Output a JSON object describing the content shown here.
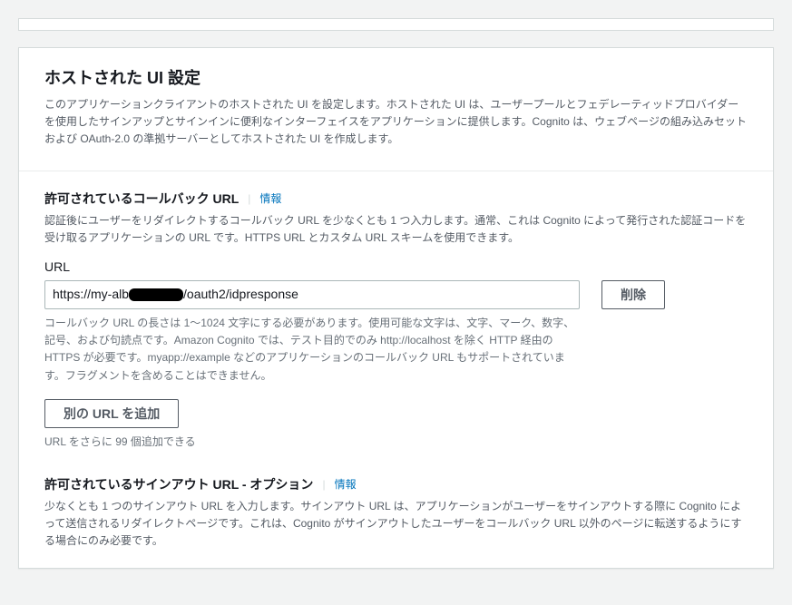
{
  "hostedUi": {
    "title": "ホストされた UI 設定",
    "description": "このアプリケーションクライアントのホストされた UI を設定します。ホストされた UI は、ユーザープールとフェデレーティッドプロバイダーを使用したサインアップとサインインに便利なインターフェイスをアプリケーションに提供します。Cognito は、ウェブページの組み込みセットおよび OAuth-2.0 の準拠サーバーとしてホストされた UI を作成します。"
  },
  "callback": {
    "title": "許可されているコールバック URL",
    "info": "情報",
    "description": "認証後にユーザーをリダイレクトするコールバック URL を少なくとも 1 つ入力します。通常、これは Cognito によって発行された認証コードを受け取るアプリケーションの URL です。HTTPS URL とカスタム URL スキームを使用できます。",
    "label": "URL",
    "value_prefix": "https://my-alb",
    "value_suffix": "/oauth2/idpresponse",
    "deleteLabel": "削除",
    "help": "コールバック URL の長さは 1〜1024 文字にする必要があります。使用可能な文字は、文字、マーク、数字、記号、および句読点です。Amazon Cognito では、テスト目的でのみ http://localhost を除く HTTP 経由の HTTPS が必要です。myapp://example などのアプリケーションのコールバック URL もサポートされています。フラグメントを含めることはできません。",
    "addLabel": "別の URL を追加",
    "remaining": "URL をさらに 99 個追加できる"
  },
  "signout": {
    "title": "許可されているサインアウト URL - オプション",
    "info": "情報",
    "description": "少なくとも 1 つのサインアウト URL を入力します。サインアウト URL は、アプリケーションがユーザーをサインアウトする際に Cognito によって送信されるリダイレクトページです。これは、Cognito がサインアウトしたユーザーをコールバック URL 以外のページに転送するようにする場合にのみ必要です。"
  }
}
